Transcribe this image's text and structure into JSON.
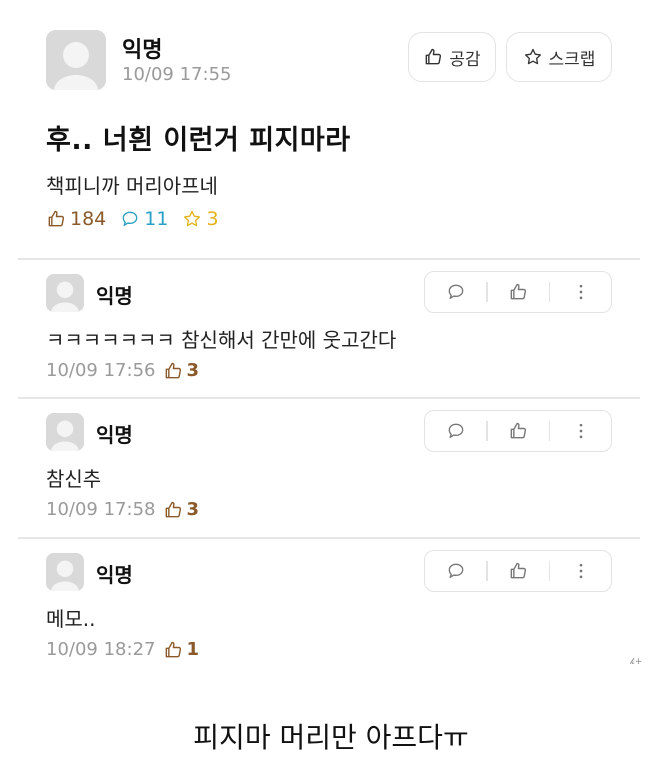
{
  "post": {
    "author": "익명",
    "time": "10/09 17:55",
    "like_button_label": "공감",
    "scrap_button_label": "스크랩",
    "title": "후.. 너흰 이런거 피지마라",
    "content": "책피니까 머리아프네",
    "stats": {
      "likes": "184",
      "comments": "11",
      "scraps": "3"
    }
  },
  "comments": [
    {
      "author": "익명",
      "text": "ㅋㅋㅋㅋㅋㅋㅋ 참신해서 간만에 웃고간다",
      "time": "10/09 17:56",
      "likes": "3"
    },
    {
      "author": "익명",
      "text": "참신추",
      "time": "10/09 17:58",
      "likes": "3"
    },
    {
      "author": "익명",
      "text": "메모..",
      "time": "10/09 18:27",
      "likes": "1"
    }
  ],
  "watermark": "𝓀+",
  "caption": "피지마 머리만 아프다ㅠ",
  "colors": {
    "like": "#8a5a2b",
    "comment": "#2aa1c4",
    "scrap": "#e3b317",
    "muted": "#9a9a9a"
  },
  "icons": [
    "avatar-icon",
    "thumbs-up-icon",
    "star-icon",
    "speech-bubble-icon",
    "more-vertical-icon"
  ]
}
